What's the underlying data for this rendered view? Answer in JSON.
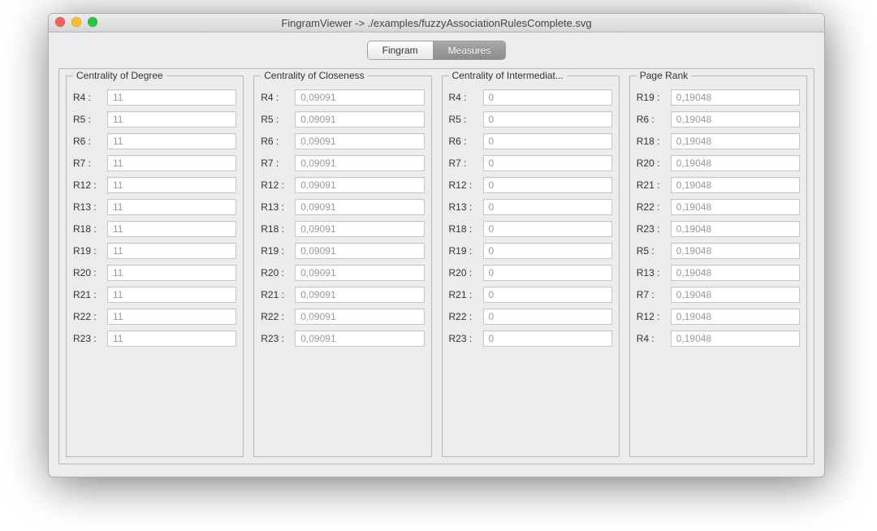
{
  "window": {
    "title": "FingramViewer -> ./examples/fuzzyAssociationRulesComplete.svg"
  },
  "tabs": {
    "items": [
      {
        "label": "Fingram",
        "selected": false
      },
      {
        "label": "Measures",
        "selected": true
      }
    ]
  },
  "groups": [
    {
      "title": "Centrality of Degree",
      "rows": [
        {
          "label": "R4 :",
          "value": "11"
        },
        {
          "label": "R5 :",
          "value": "11"
        },
        {
          "label": "R6 :",
          "value": "11"
        },
        {
          "label": "R7 :",
          "value": "11"
        },
        {
          "label": "R12 :",
          "value": "11"
        },
        {
          "label": "R13 :",
          "value": "11"
        },
        {
          "label": "R18 :",
          "value": "11"
        },
        {
          "label": "R19 :",
          "value": "11"
        },
        {
          "label": "R20 :",
          "value": "11"
        },
        {
          "label": "R21 :",
          "value": "11"
        },
        {
          "label": "R22 :",
          "value": "11"
        },
        {
          "label": "R23 :",
          "value": "11"
        }
      ]
    },
    {
      "title": "Centrality of Closeness",
      "rows": [
        {
          "label": "R4 :",
          "value": "0,09091"
        },
        {
          "label": "R5 :",
          "value": "0,09091"
        },
        {
          "label": "R6 :",
          "value": "0,09091"
        },
        {
          "label": "R7 :",
          "value": "0,09091"
        },
        {
          "label": "R12 :",
          "value": "0,09091"
        },
        {
          "label": "R13 :",
          "value": "0,09091"
        },
        {
          "label": "R18 :",
          "value": "0,09091"
        },
        {
          "label": "R19 :",
          "value": "0,09091"
        },
        {
          "label": "R20 :",
          "value": "0,09091"
        },
        {
          "label": "R21 :",
          "value": "0,09091"
        },
        {
          "label": "R22 :",
          "value": "0,09091"
        },
        {
          "label": "R23 :",
          "value": "0,09091"
        }
      ]
    },
    {
      "title": "Centrality of Intermediat...",
      "rows": [
        {
          "label": "R4 :",
          "value": "0"
        },
        {
          "label": "R5 :",
          "value": "0"
        },
        {
          "label": "R6 :",
          "value": "0"
        },
        {
          "label": "R7 :",
          "value": "0"
        },
        {
          "label": "R12 :",
          "value": "0"
        },
        {
          "label": "R13 :",
          "value": "0"
        },
        {
          "label": "R18 :",
          "value": "0"
        },
        {
          "label": "R19 :",
          "value": "0"
        },
        {
          "label": "R20 :",
          "value": "0"
        },
        {
          "label": "R21 :",
          "value": "0"
        },
        {
          "label": "R22 :",
          "value": "0"
        },
        {
          "label": "R23 :",
          "value": "0"
        }
      ]
    },
    {
      "title": "Page Rank",
      "rows": [
        {
          "label": "R19 :",
          "value": "0,19048"
        },
        {
          "label": "R6 :",
          "value": "0,19048"
        },
        {
          "label": "R18 :",
          "value": "0,19048"
        },
        {
          "label": "R20 :",
          "value": "0,19048"
        },
        {
          "label": "R21 :",
          "value": "0,19048"
        },
        {
          "label": "R22 :",
          "value": "0,19048"
        },
        {
          "label": "R23 :",
          "value": "0,19048"
        },
        {
          "label": "R5 :",
          "value": "0,19048"
        },
        {
          "label": "R13 :",
          "value": "0,19048"
        },
        {
          "label": "R7 :",
          "value": "0,19048"
        },
        {
          "label": "R12 :",
          "value": "0,19048"
        },
        {
          "label": "R4 :",
          "value": "0,19048"
        }
      ]
    }
  ]
}
